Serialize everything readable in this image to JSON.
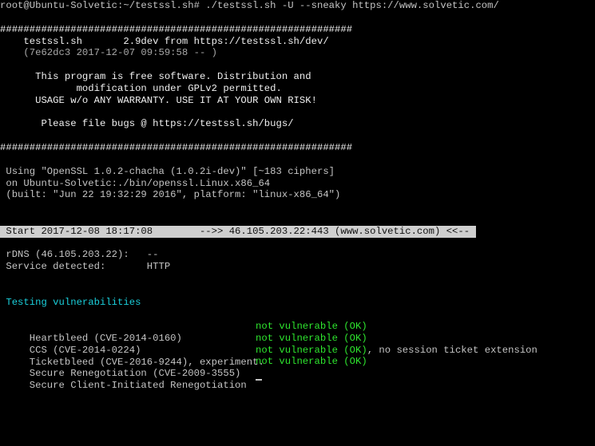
{
  "terminal": {
    "prompt_line": "root@Ubuntu-Solvetic:~/testssl.sh# ./testssl.sh -U --sneaky https://www.solvetic.com/",
    "hash_rule": "############################################################",
    "banner": {
      "version_line": "    testssl.sh       2.9dev from https://testssl.sh/dev/",
      "commit_line": "    (7e62dc3 2017-12-07 09:59:58 -- )",
      "license_1": "      This program is free software. Distribution and",
      "license_2": "             modification under GPLv2 permitted.",
      "license_3": "      USAGE w/o ANY WARRANTY. USE IT AT YOUR OWN RISK!",
      "bugs_line": "       Please file bugs @ https://testssl.sh/bugs/"
    },
    "openssl": {
      "line_1": " Using \"OpenSSL 1.0.2-chacha (1.0.2i-dev)\" [~183 ciphers]",
      "line_2": " on Ubuntu-Solvetic:./bin/openssl.Linux.x86_64",
      "line_3": " (built: \"Jun 22 19:32:29 2016\", platform: \"linux-x86_64\")"
    },
    "start_bar": " Start 2017-12-08 18:17:08        -->> 46.105.203.22:443 (www.solvetic.com) <<--",
    "rdns_line": " rDNS (46.105.203.22):   --",
    "service_line": " Service detected:       HTTP",
    "section_heading": " Testing vulnerabilities",
    "vulnerabilities": [
      {
        "label": " Heartbleed (CVE-2014-0160)",
        "status": "not vulnerable (OK)",
        "note": ""
      },
      {
        "label": " CCS (CVE-2014-0224)",
        "status": "not vulnerable (OK)",
        "note": ""
      },
      {
        "label": " Ticketbleed (CVE-2016-9244), experiment.",
        "status": "not vulnerable (OK)",
        "note": ", no session ticket extension"
      },
      {
        "label": " Secure Renegotiation (CVE-2009-3555)",
        "status": "not vulnerable (OK)",
        "note": ""
      },
      {
        "label": " Secure Client-Initiated Renegotiation",
        "status": "",
        "note": ""
      }
    ]
  }
}
